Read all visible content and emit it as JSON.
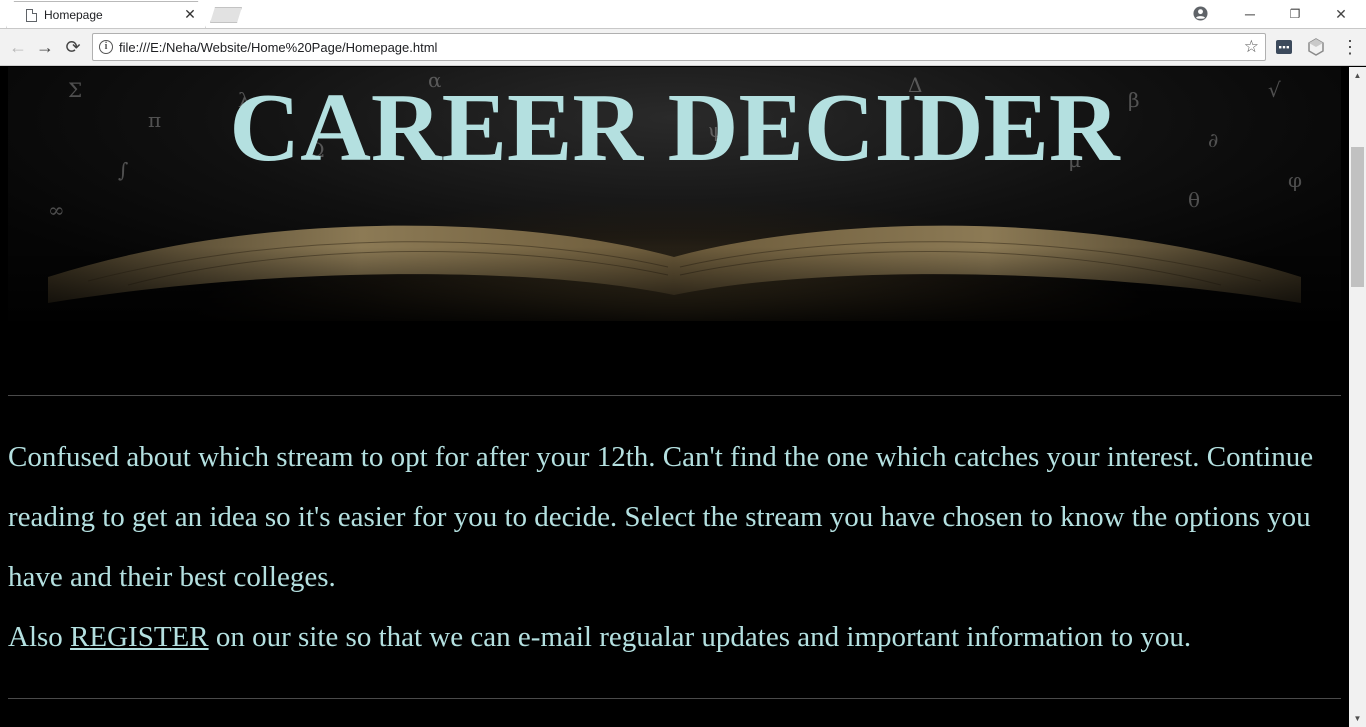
{
  "browser": {
    "tab_title": "Homepage",
    "tab_close_glyph": "✕",
    "url": "file:///E:/Neha/Website/Home%20Page/Homepage.html",
    "back_glyph": "←",
    "forward_glyph": "→",
    "reload_glyph": "⟳",
    "star_glyph": "☆",
    "menu_glyph": "⋮",
    "minimize_glyph": "─",
    "restore_glyph": "❐",
    "close_glyph": "✕",
    "info_glyph": "i",
    "scroll_up_glyph": "▲",
    "scroll_down_glyph": "▼"
  },
  "page": {
    "hero_title": "CAREER DECIDER",
    "paragraph_1": "Confused about which stream to opt for after your 12th. Can't find the one which catches your interest. Continue reading to get an idea so it's easier for you to decide. Select the stream you have chosen to know the options you have and their best colleges.",
    "paragraph_2_prefix": "Also ",
    "register_link": "REGISTER",
    "paragraph_2_suffix": " on our site so that we can e-mail regualar updates and important information to you."
  },
  "colors": {
    "page_background": "#000000",
    "text_color": "#b4e0e0"
  }
}
